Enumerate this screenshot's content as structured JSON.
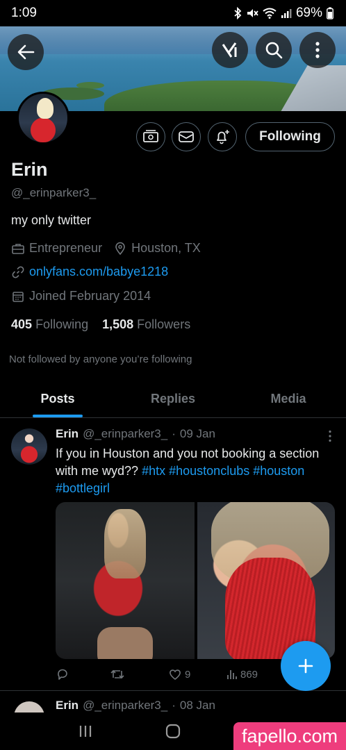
{
  "status_bar": {
    "time": "1:09",
    "battery": "69%"
  },
  "banner": {
    "icons": [
      "back-arrow-icon",
      "grok-icon",
      "search-icon",
      "more-vertical-icon"
    ]
  },
  "profile": {
    "name": "Erin",
    "handle": "@_erinparker3_",
    "bio": "my only twitter",
    "category": "Entrepreneur",
    "location": "Houston, TX",
    "link": "onlyfans.com/babye1218",
    "joined": "Joined February 2014",
    "following_count": "405",
    "following_label": "Following",
    "followers_count": "1,508",
    "followers_label": "Followers",
    "not_followed_note": "Not followed by anyone you’re following",
    "follow_button_label": "Following"
  },
  "tabs": [
    {
      "label": "Posts",
      "active": true
    },
    {
      "label": "Replies",
      "active": false
    },
    {
      "label": "Media",
      "active": false
    }
  ],
  "post": {
    "author": "Erin",
    "handle": "@_erinparker3_",
    "separator": "·",
    "date": "09 Jan",
    "text_plain": "If you in Houston and you not booking a section with me wyd??",
    "tags": [
      "#htx",
      "#houstonclubs",
      "#houston",
      "#bottlegirl"
    ],
    "likes": "9",
    "views": "869"
  },
  "next_post": {
    "author": "Erin",
    "handle": "@_erinparker3_",
    "separator": "·",
    "date": "08 Jan"
  },
  "watermark": "fapello.com",
  "colors": {
    "accent": "#1d9bf0",
    "background": "#000000",
    "muted": "#71767b",
    "text": "#e7e9ea",
    "watermark": "#ee3d7d"
  }
}
